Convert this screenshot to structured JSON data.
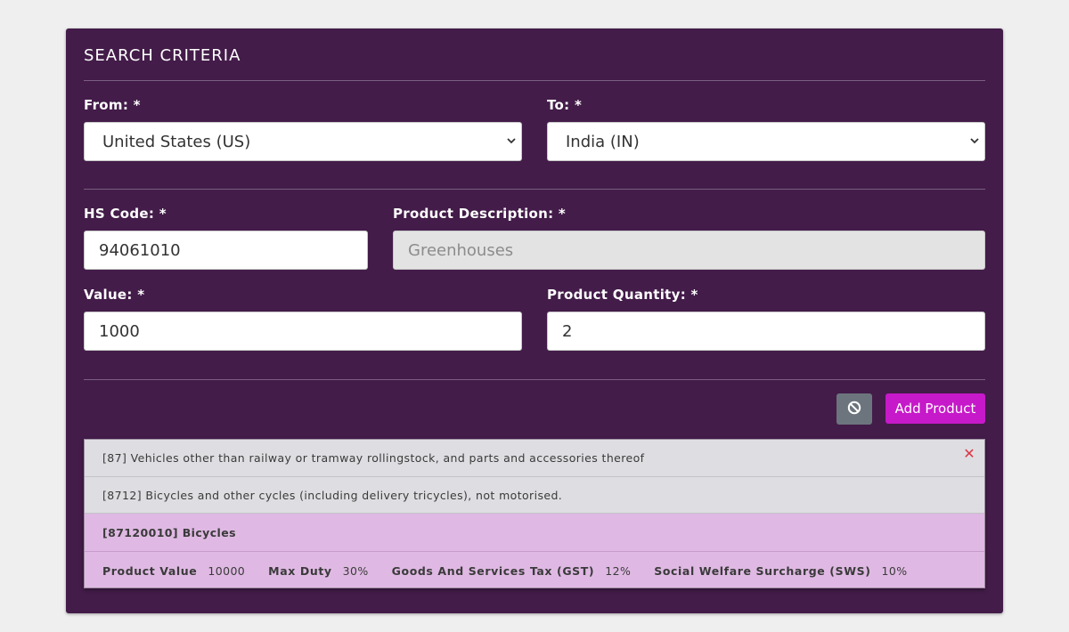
{
  "search": {
    "title": "SEARCH CRITERIA",
    "from_label": "From: *",
    "from_value": "United States (US)",
    "to_label": "To: *",
    "to_value": "India (IN)",
    "hs_label": "HS Code: *",
    "hs_value": "94061010",
    "desc_label": "Product Description: *",
    "desc_value": "Greenhouses",
    "value_label": "Value: *",
    "value_value": "1000",
    "qty_label": "Product Quantity: *",
    "qty_value": "2"
  },
  "actions": {
    "add_label": "Add Product"
  },
  "result": {
    "chapter": "[87] Vehicles other than railway or tramway rollingstock, and parts and accessories thereof",
    "heading": "[8712] Bicycles and other cycles (including delivery tricycles), not motorised.",
    "item": "[87120010] Bicycles",
    "details": [
      {
        "key": "Product Value",
        "value": "10000"
      },
      {
        "key": "Max Duty",
        "value": "30%"
      },
      {
        "key": "Goods And Services Tax (GST)",
        "value": "12%"
      },
      {
        "key": "Social Welfare Surcharge (SWS)",
        "value": "10%"
      }
    ]
  },
  "icons": {
    "close": "close-icon",
    "cancel": "ban-icon",
    "select": "chevron-down-icon"
  },
  "colors": {
    "panel": "#431c49",
    "accent": "#c619c9",
    "result_grey": "#dedee2",
    "result_pink": "#dfb9e3",
    "close": "#dc3545"
  }
}
